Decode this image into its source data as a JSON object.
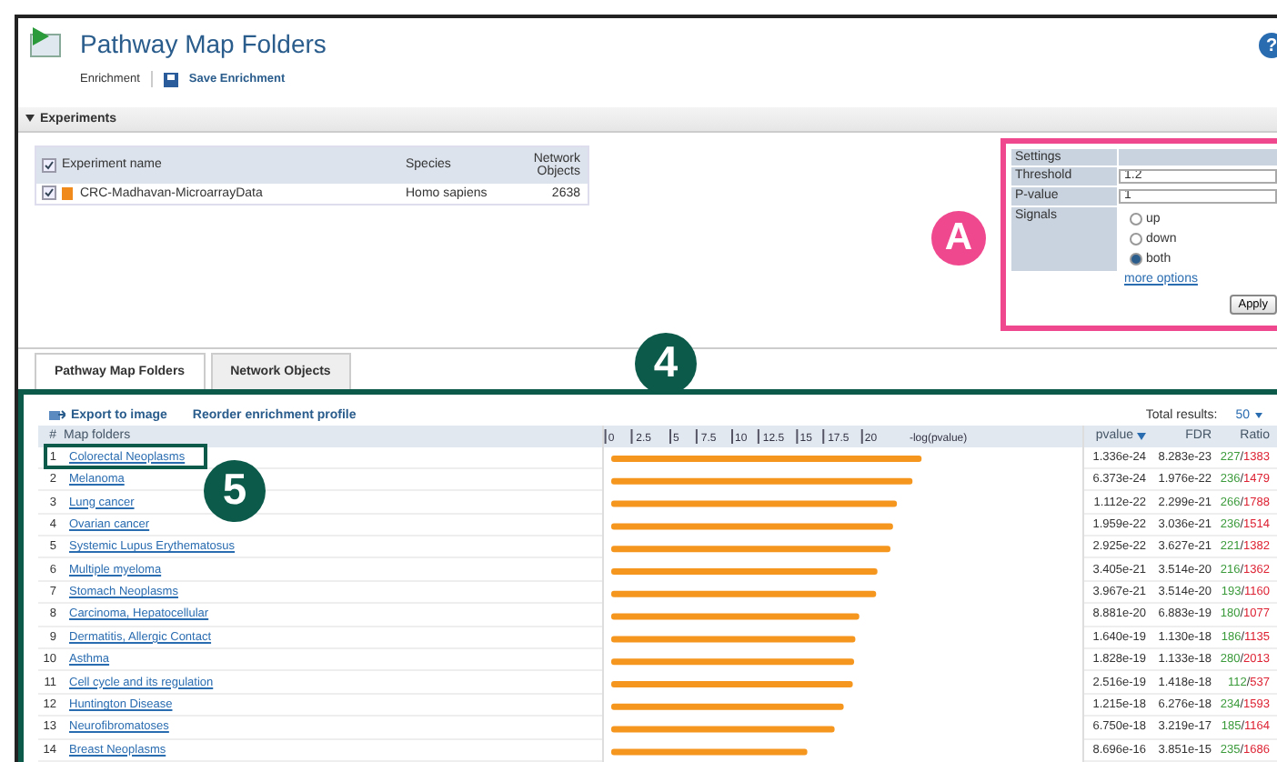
{
  "header": {
    "title": "Pathway Map Folders",
    "breadcrumb": "Enrichment",
    "save_action": "Save Enrichment",
    "help": "?"
  },
  "experiments": {
    "title": "Experiments",
    "expanded": true,
    "columns": [
      "Experiment name",
      "Species",
      "Network Objects"
    ],
    "all_checked": true,
    "rows": [
      {
        "checked": true,
        "name": "CRC-Madhavan-MicroarrayData",
        "species": "Homo sapiens",
        "objects": "2638",
        "color": "#f08a1c"
      }
    ]
  },
  "settings": {
    "title": "Settings",
    "threshold_label": "Threshold",
    "threshold": "1.2",
    "pvalue_label": "P-value",
    "pvalue": "1",
    "signals_label": "Signals",
    "signals": [
      {
        "label": "up",
        "selected": false
      },
      {
        "label": "down",
        "selected": false
      },
      {
        "label": "both",
        "selected": true
      }
    ],
    "more_options": "more options",
    "apply": "Apply"
  },
  "tabs": [
    {
      "label": "Pathway Map Folders",
      "selected": true
    },
    {
      "label": "Network Objects",
      "selected": false
    }
  ],
  "results": {
    "export": "Export to image",
    "reorder": "Reorder enrichment profile",
    "total_label": "Total results:",
    "total": "50",
    "columns": {
      "index": "#",
      "name": "Map folders",
      "pvalue": "pvalue",
      "fdr": "FDR",
      "ratio": "Ratio"
    },
    "rows": [
      {
        "index": "1",
        "name": "Colorectal Neoplasms",
        "pvalue": "1.336e-24",
        "fdr": "8.283e-23",
        "ratio": "227/1383"
      },
      {
        "index": "2",
        "name": "Melanoma",
        "pvalue": "6.373e-24",
        "fdr": "1.976e-22",
        "ratio": "236/1479"
      },
      {
        "index": "3",
        "name": "Lung cancer",
        "pvalue": "1.112e-22",
        "fdr": "2.299e-21",
        "ratio": "266/1788"
      },
      {
        "index": "4",
        "name": "Ovarian cancer",
        "pvalue": "1.959e-22",
        "fdr": "3.036e-21",
        "ratio": "236/1514"
      },
      {
        "index": "5",
        "name": "Systemic Lupus Erythematosus",
        "pvalue": "2.925e-22",
        "fdr": "3.627e-21",
        "ratio": "221/1382"
      },
      {
        "index": "6",
        "name": "Multiple myeloma",
        "pvalue": "3.405e-21",
        "fdr": "3.514e-20",
        "ratio": "216/1362"
      },
      {
        "index": "7",
        "name": "Stomach Neoplasms",
        "pvalue": "3.967e-21",
        "fdr": "3.514e-20",
        "ratio": "193/1160"
      },
      {
        "index": "8",
        "name": "Carcinoma, Hepatocellular",
        "pvalue": "8.881e-20",
        "fdr": "6.883e-19",
        "ratio": "180/1077"
      },
      {
        "index": "9",
        "name": "Dermatitis, Allergic Contact",
        "pvalue": "1.640e-19",
        "fdr": "1.130e-18",
        "ratio": "186/1135"
      },
      {
        "index": "10",
        "name": "Asthma",
        "pvalue": "1.828e-19",
        "fdr": "1.133e-18",
        "ratio": "280/2013"
      },
      {
        "index": "11",
        "name": "Cell cycle and its regulation",
        "pvalue": "2.516e-19",
        "fdr": "1.418e-18",
        "ratio": "112/537"
      },
      {
        "index": "12",
        "name": "Huntington Disease",
        "pvalue": "1.215e-18",
        "fdr": "6.276e-18",
        "ratio": "234/1593"
      },
      {
        "index": "13",
        "name": "Neurofibromatoses",
        "pvalue": "6.750e-18",
        "fdr": "3.219e-17",
        "ratio": "185/1164"
      },
      {
        "index": "14",
        "name": "Breast Neoplasms",
        "pvalue": "8.696e-16",
        "fdr": "3.851e-15",
        "ratio": "235/1686"
      }
    ],
    "chart_data": {
      "type": "bar",
      "orientation": "horizontal",
      "xlabel": "-log(pvalue)",
      "series": [
        {
          "color": "#f5961e",
          "values": [
            23.9,
            23.2,
            22.0,
            21.7,
            21.5,
            20.5,
            20.4,
            19.1,
            18.8,
            18.7,
            18.6,
            17.9,
            17.2,
            15.1
          ]
        }
      ],
      "xlim": [
        0,
        36
      ],
      "xticks": [
        0,
        2.5,
        5,
        7.5,
        10,
        12.5,
        15,
        17.5,
        20
      ]
    }
  },
  "callouts": [
    {
      "label": "A",
      "color": "#f0488f"
    },
    {
      "label": "4",
      "color": "#0b5a4a"
    },
    {
      "label": "5",
      "color": "#0b5a4a"
    }
  ]
}
